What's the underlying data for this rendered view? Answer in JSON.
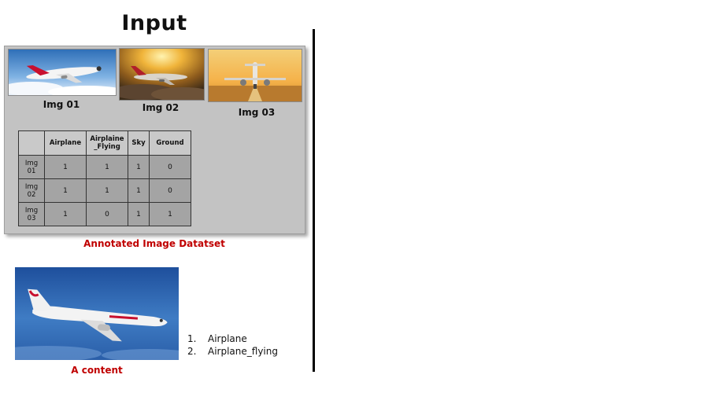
{
  "title": "Input",
  "dataset": {
    "images": [
      {
        "caption": "Img 01"
      },
      {
        "caption": "Img 02"
      },
      {
        "caption": "Img 03"
      }
    ],
    "table": {
      "columns": [
        "",
        "Airplane",
        "Airplaine\n_Flying",
        "Sky",
        "Ground"
      ],
      "rows": [
        {
          "label": "Img\n01",
          "values": [
            "1",
            "1",
            "1",
            "0"
          ]
        },
        {
          "label": "Img\n02",
          "values": [
            "1",
            "1",
            "1",
            "0"
          ]
        },
        {
          "label": "Img\n03",
          "values": [
            "1",
            "0",
            "1",
            "1"
          ]
        }
      ]
    },
    "label": "Annotated Image Datatset"
  },
  "content": {
    "label": "A content",
    "predictions": [
      {
        "num": "1.",
        "text": "Airplane"
      },
      {
        "num": "2.",
        "text": "Airplane_flying"
      }
    ]
  },
  "colors": {
    "label_red": "#c00000",
    "panel_gray": "#c3c3c3",
    "cell_gray": "#a4a4a4"
  }
}
